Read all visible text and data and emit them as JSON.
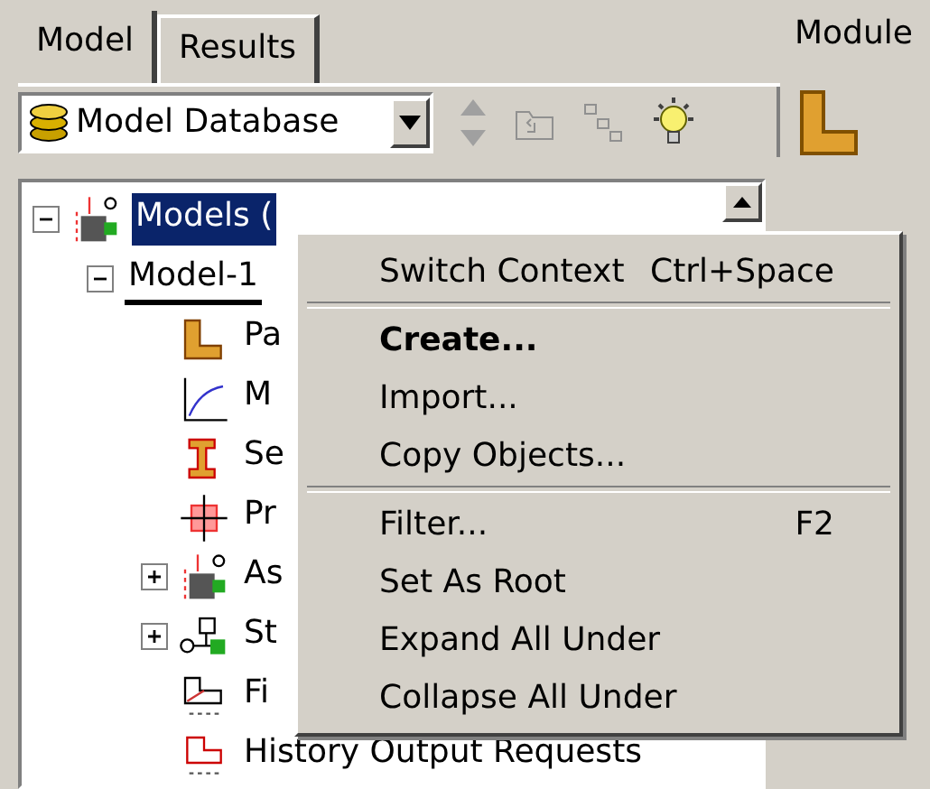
{
  "tabs": [
    {
      "label": "Model",
      "selected": true
    },
    {
      "label": "Results",
      "selected": false
    }
  ],
  "database_select": {
    "value": "Model Database"
  },
  "tree": [
    {
      "label": "Models (",
      "kind": "models",
      "selected": true,
      "current": false,
      "expanded": true,
      "children": [
        {
          "label": "Model-1",
          "selected": false,
          "current": true,
          "expanded": true,
          "children": [
            {
              "label": "Pa",
              "kind": "part",
              "selected": false,
              "current": false
            },
            {
              "label": "M",
              "kind": "material",
              "selected": false,
              "current": false
            },
            {
              "label": "Se",
              "kind": "section",
              "selected": false,
              "current": false
            },
            {
              "label": "Pr",
              "kind": "profile",
              "selected": false,
              "current": false
            },
            {
              "label": "As",
              "kind": "assembly",
              "selected": false,
              "current": false,
              "expanded": false
            },
            {
              "label": "St",
              "kind": "step",
              "selected": false,
              "current": false,
              "expanded": false
            },
            {
              "label": "Fi",
              "kind": "field",
              "selected": false,
              "current": false
            },
            {
              "label": "History Output Requests",
              "kind": "history",
              "selected": false,
              "current": false
            }
          ]
        }
      ]
    }
  ],
  "module_label": "Module",
  "context_menu": [
    {
      "kind": "item",
      "label": "Switch Context",
      "shortcut": "Ctrl+Space",
      "default": false
    },
    {
      "kind": "separator"
    },
    {
      "kind": "item",
      "label": "Create...",
      "default": true
    },
    {
      "kind": "item",
      "label": "Import...",
      "default": false
    },
    {
      "kind": "item",
      "label": "Copy Objects...",
      "default": false
    },
    {
      "kind": "separator"
    },
    {
      "kind": "item",
      "label": "Filter...",
      "shortcut": "F2",
      "default": false
    },
    {
      "kind": "item",
      "label": "Set As Root",
      "default": false
    },
    {
      "kind": "item",
      "label": "Expand All Under",
      "default": false
    },
    {
      "kind": "item",
      "label": "Collapse All Under",
      "default": false
    }
  ]
}
